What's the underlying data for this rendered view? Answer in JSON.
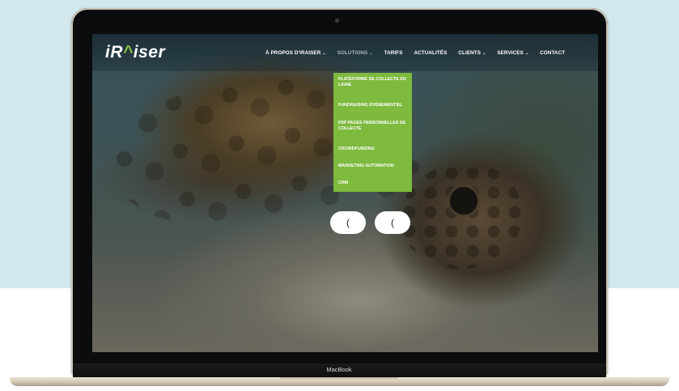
{
  "site": {
    "logo_prefix": "iR",
    "logo_accent": "^",
    "logo_suffix": "iser"
  },
  "nav": {
    "items": [
      {
        "label": "À PROPOS D'IRAISER",
        "has_dropdown": true
      },
      {
        "label": "SOLUTIONS",
        "has_dropdown": true,
        "active": true
      },
      {
        "label": "TARIFS",
        "has_dropdown": false
      },
      {
        "label": "ACTUALITÉS",
        "has_dropdown": false
      },
      {
        "label": "CLIENTS",
        "has_dropdown": true
      },
      {
        "label": "SERVICES",
        "has_dropdown": true
      },
      {
        "label": "CONTACT",
        "has_dropdown": false
      }
    ],
    "caret": "⌄"
  },
  "dropdown": {
    "items": [
      "PLATEFORME DE COLLECTE EN LIGNE",
      "FUNDRAISING ÉVÉNEMENTIEL",
      "P2P PAGES PERSONNELLES DE COLLECTE",
      "CROWDFUNDING",
      "MARKETING AUTOMATION",
      "CRM"
    ]
  },
  "slider": {
    "prev_label": "(",
    "next_label": "("
  },
  "device": {
    "label": "MacBook"
  },
  "colors": {
    "brand_green": "#7dba3e",
    "background_top": "#d3e8ec",
    "laptop_bezel": "#0b0c0d"
  }
}
